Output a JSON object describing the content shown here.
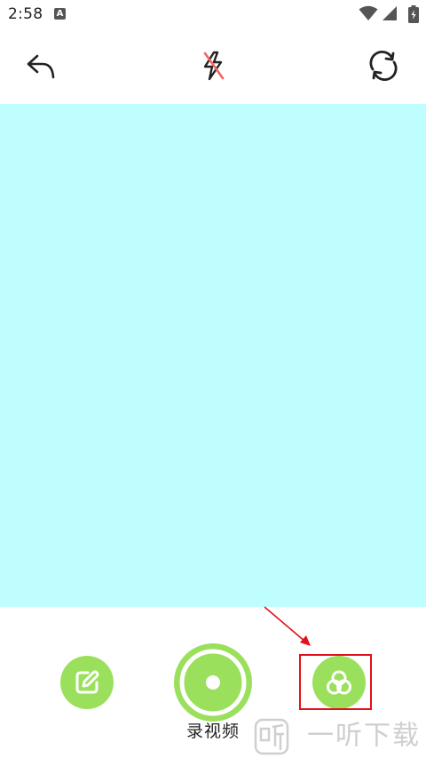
{
  "status_bar": {
    "time": "2:58",
    "notification_letter": "A",
    "icons": [
      "wifi-icon",
      "signal-icon",
      "battery-icon"
    ]
  },
  "toolbar": {
    "icons": [
      "back-arrow-icon",
      "flash-off-icon",
      "switch-camera-icon"
    ]
  },
  "preview": {
    "background": "#bffeff"
  },
  "bottom_bar": {
    "accent_color": "#9be05c",
    "record_label": "录视频",
    "icons": [
      "edit-icon",
      "record-icon",
      "filter-icon"
    ]
  },
  "annotation": {
    "color": "#e3101b"
  },
  "watermark": {
    "text": "一听下载"
  }
}
